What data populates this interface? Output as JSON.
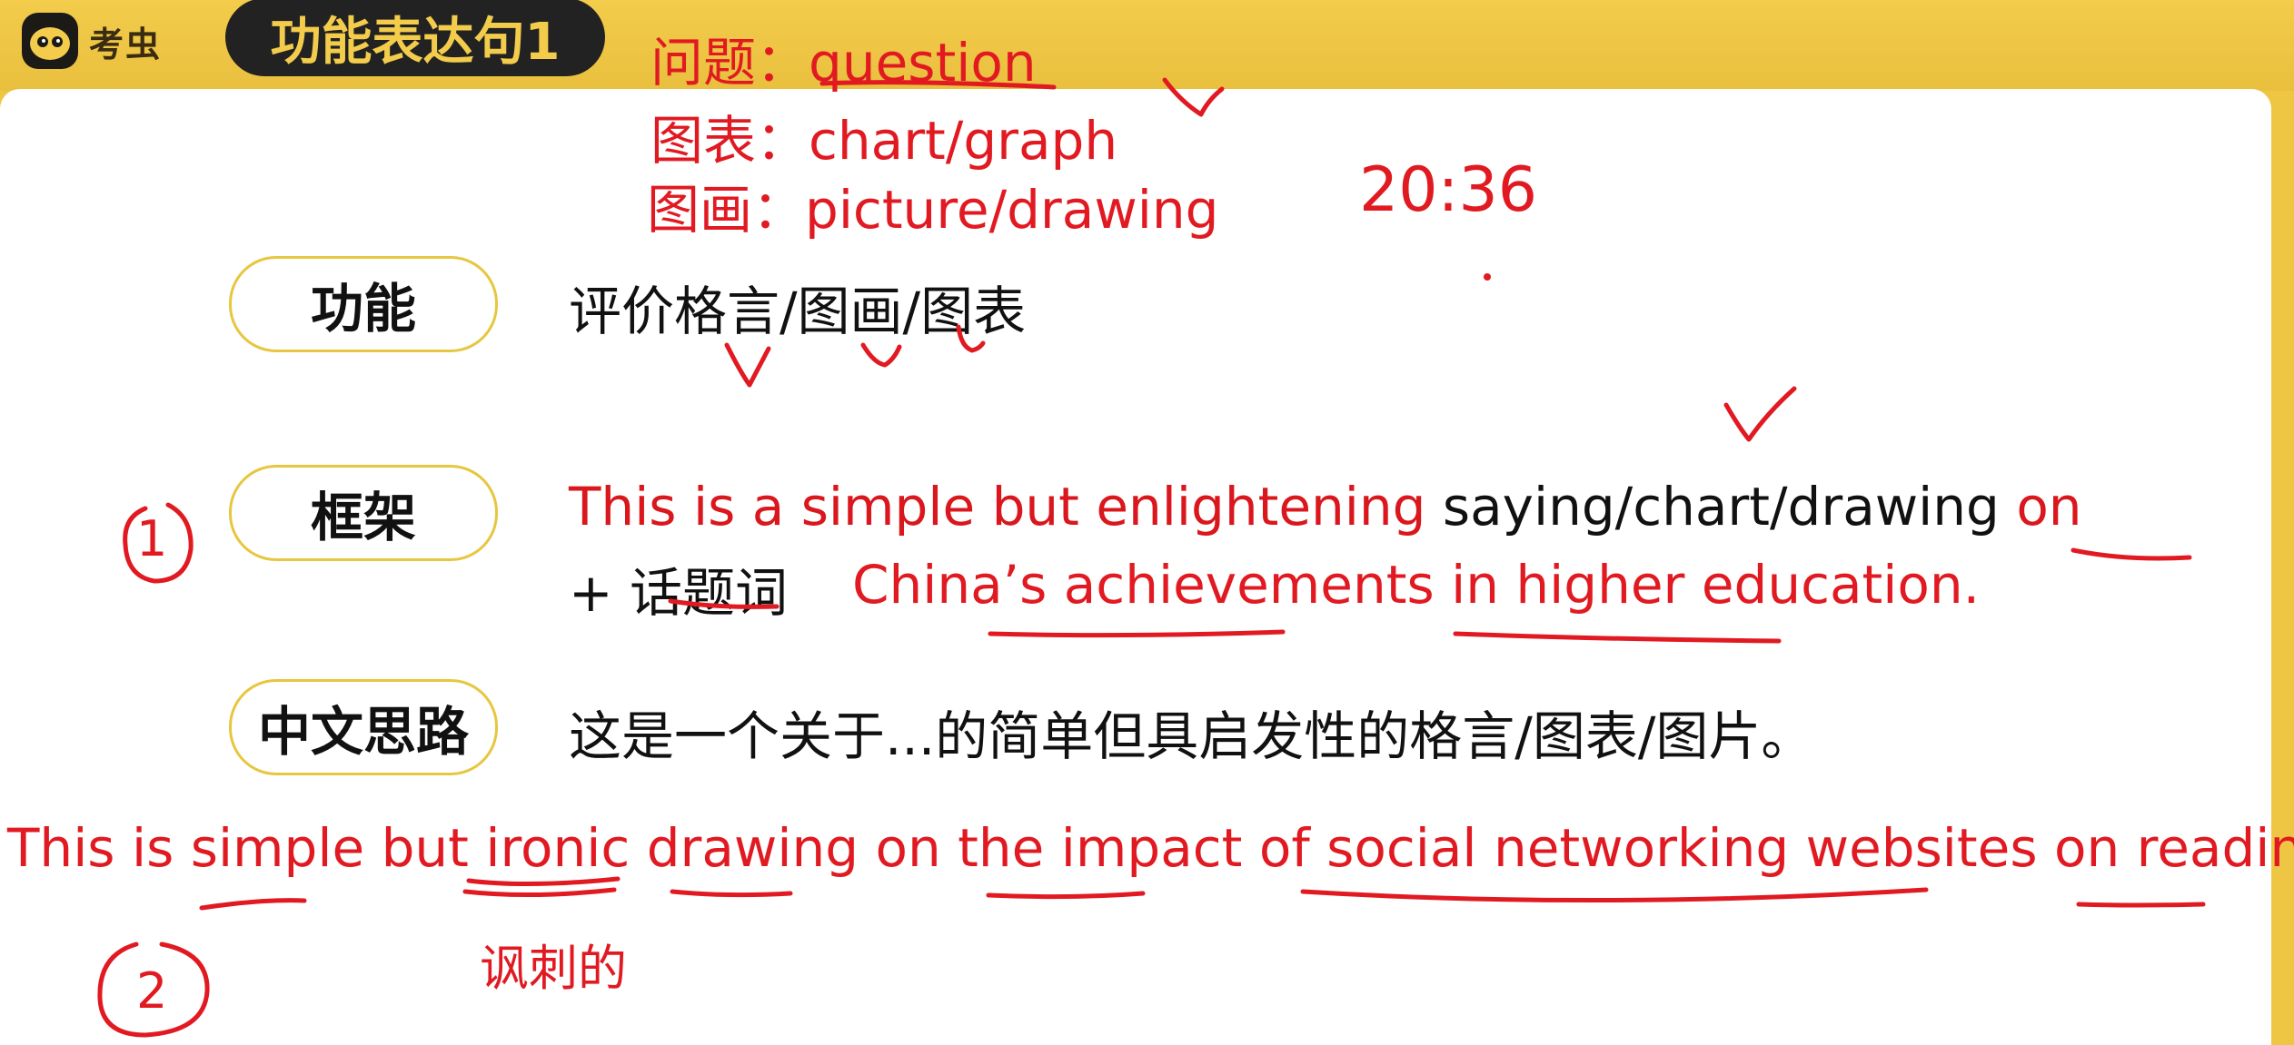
{
  "header": {
    "logo_text": "考虫",
    "title": "功能表达句1"
  },
  "annotations": {
    "question_line": "问题：question",
    "chart_line": "图表：chart/graph",
    "picture_line": "图画：picture/drawing",
    "time": "20:36",
    "circle_1": "1",
    "circle_2": "2",
    "ironic_gloss": "讽刺的",
    "topic_example": "China’s achievements in higher education.",
    "example_sentence": "This is simple but ironic drawing on the impact of social networking websites on reading."
  },
  "rows": {
    "function_label": "功能",
    "function_text": "评价格言/图画/图表",
    "frame_label": "框架",
    "frame_red": "This is a simple but enlightening",
    "frame_black": " saying/chart/drawing ",
    "frame_on": "on",
    "frame_line2": "+ 话题词",
    "chinese_label": "中文思路",
    "chinese_text": "这是一个关于...的简单但具启发性的格言/图表/图片。"
  },
  "colors": {
    "header_yellow": "#efc643",
    "pill_border": "#e7c640",
    "ink_red": "#e11a22"
  }
}
